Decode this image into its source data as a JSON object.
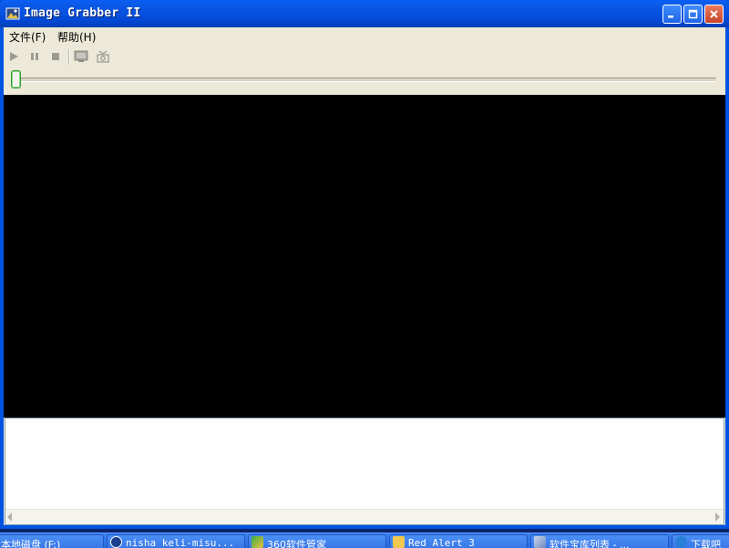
{
  "window": {
    "title": "Image Grabber II"
  },
  "menu": {
    "file_label": "文件(F)",
    "help_label": "帮助(H)"
  },
  "toolbar": {
    "play": "play-icon",
    "pause": "pause-icon",
    "stop": "stop-icon",
    "monitor": "monitor-icon",
    "capture": "capture-icon"
  },
  "slider": {
    "position_fraction": 0
  },
  "taskbar": {
    "items": [
      {
        "label": "本地磁盘 (F:)"
      },
      {
        "label": "nisha keli-misu..."
      },
      {
        "label": "360软件管家"
      },
      {
        "label": "Red Alert 3"
      },
      {
        "label": "软件宝库列表 - ..."
      },
      {
        "label": "下载吧"
      }
    ]
  },
  "colors": {
    "titlebar": "#0851e0",
    "window_bg": "#ece9d8",
    "video_bg": "#000000",
    "taskbar": "#2b6cdd"
  }
}
